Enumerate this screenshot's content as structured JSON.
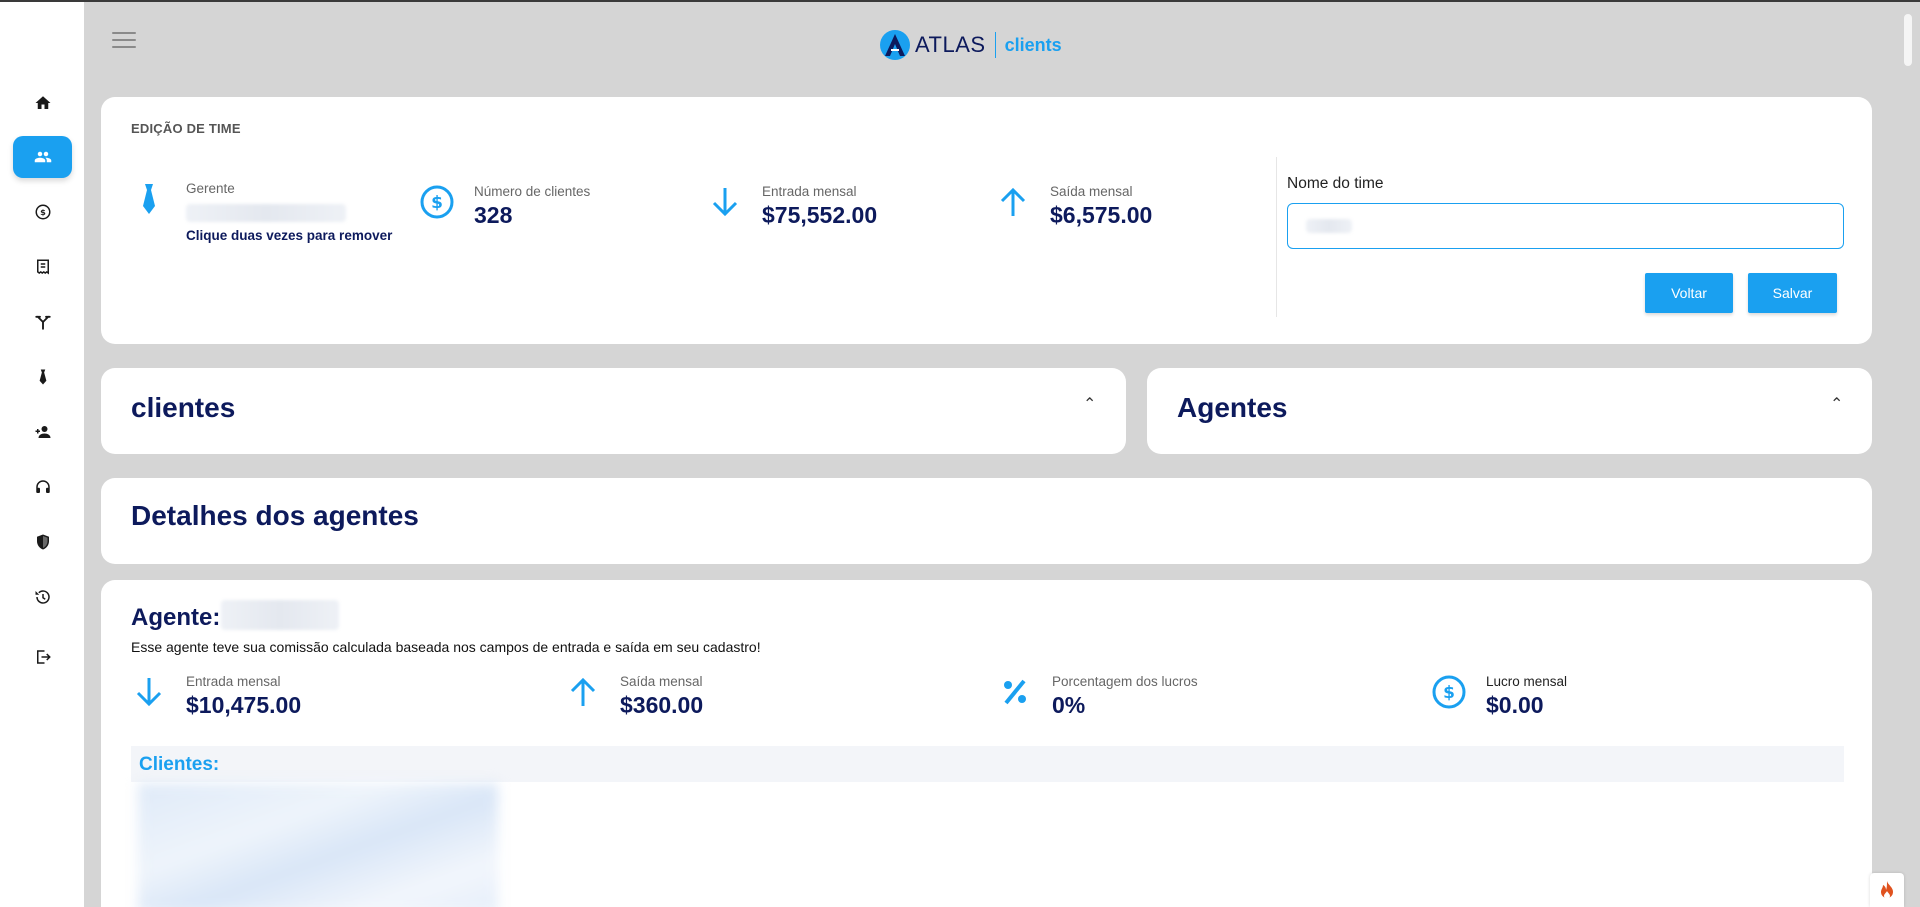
{
  "app": {
    "logo_atlas": "ATLAS",
    "logo_clients": "clients",
    "accent_color": "#1aa0f0",
    "navy_color": "#0d1a5c"
  },
  "sidebar": {
    "items": [
      {
        "icon": "home-icon"
      },
      {
        "icon": "group-icon",
        "active": true
      },
      {
        "icon": "dollar-coin-icon"
      },
      {
        "icon": "receipt-icon"
      },
      {
        "icon": "merge-icon"
      },
      {
        "icon": "tie-icon"
      },
      {
        "icon": "person-add-icon"
      },
      {
        "icon": "headset-icon"
      },
      {
        "icon": "shield-icon"
      },
      {
        "icon": "history-icon"
      },
      {
        "icon": "logout-icon"
      }
    ]
  },
  "team_edit": {
    "section_label": "EDIÇÃO DE TIME",
    "manager": {
      "label": "Gerente",
      "remove_hint": "Clique duas vezes para remover"
    },
    "stats": [
      {
        "label": "Número de clientes",
        "value": "328",
        "icon": "dollar-circle-icon"
      },
      {
        "label": "Entrada mensal",
        "value": "$75,552.00",
        "icon": "arrow-down-icon"
      },
      {
        "label": "Saída mensal",
        "value": "$6,575.00",
        "icon": "arrow-up-icon"
      }
    ],
    "team_name": {
      "label": "Nome do time",
      "value": ""
    },
    "buttons": {
      "back": "Voltar",
      "save": "Salvar"
    }
  },
  "panels": {
    "clients_title": "clientes",
    "agents_title": "Agentes",
    "agent_details_title": "Detalhes dos agentes"
  },
  "agent_card": {
    "title": "Agente:",
    "note": "Esse agente teve sua comissão calculada baseada nos campos de entrada e saída em seu cadastro!",
    "stats": [
      {
        "label": "Entrada mensal",
        "value": "$10,475.00",
        "icon": "arrow-down-icon"
      },
      {
        "label": "Saída mensal",
        "value": "$360.00",
        "icon": "arrow-up-icon"
      },
      {
        "label": "Porcentagem dos lucros",
        "value": "0%",
        "icon": "percent-icon"
      },
      {
        "label": "Lucro mensal",
        "value": "$0.00",
        "icon": "dollar-circle-icon"
      }
    ],
    "clients_label": "Clientes:"
  }
}
